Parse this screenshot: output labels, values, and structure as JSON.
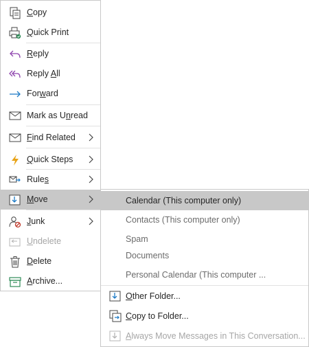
{
  "context_menu": {
    "items": [
      {
        "pre": "",
        "ul": "C",
        "post": "opy"
      },
      {
        "pre": "",
        "ul": "Q",
        "post": "uick Print"
      },
      {
        "pre": "",
        "ul": "R",
        "post": "eply"
      },
      {
        "pre": "Reply ",
        "ul": "A",
        "post": "ll"
      },
      {
        "pre": "For",
        "ul": "w",
        "post": "ard"
      },
      {
        "pre": "Mark as U",
        "ul": "n",
        "post": "read"
      },
      {
        "pre": "",
        "ul": "F",
        "post": "ind Related"
      },
      {
        "pre": "",
        "ul": "Q",
        "post": "uick Steps"
      },
      {
        "pre": "Rule",
        "ul": "s",
        "post": ""
      },
      {
        "pre": "",
        "ul": "M",
        "post": "ove"
      },
      {
        "pre": "",
        "ul": "J",
        "post": "unk"
      },
      {
        "pre": "",
        "ul": "U",
        "post": "ndelete"
      },
      {
        "pre": "",
        "ul": "D",
        "post": "elete"
      },
      {
        "pre": "",
        "ul": "A",
        "post": "rchive..."
      }
    ]
  },
  "move_submenu": {
    "folders": [
      "Calendar (This computer only)",
      "Contacts (This computer only)",
      "Spam",
      "Documents",
      "Personal Calendar (This computer ..."
    ],
    "actions": [
      {
        "pre": "",
        "ul": "O",
        "post": "ther Folder..."
      },
      {
        "pre": "",
        "ul": "C",
        "post": "opy to Folder..."
      },
      {
        "pre": "",
        "ul": "A",
        "post": "lways Move Messages in This Conversation..."
      }
    ]
  },
  "colors": {
    "hover_bg": "#c8c8c8",
    "disabled_text": "#a6a6a6",
    "accent_blue": "#1e7bc6",
    "quick_steps_orange": "#e8a317",
    "archive_green": "#2e8b57",
    "junk_red": "#c0392b"
  }
}
